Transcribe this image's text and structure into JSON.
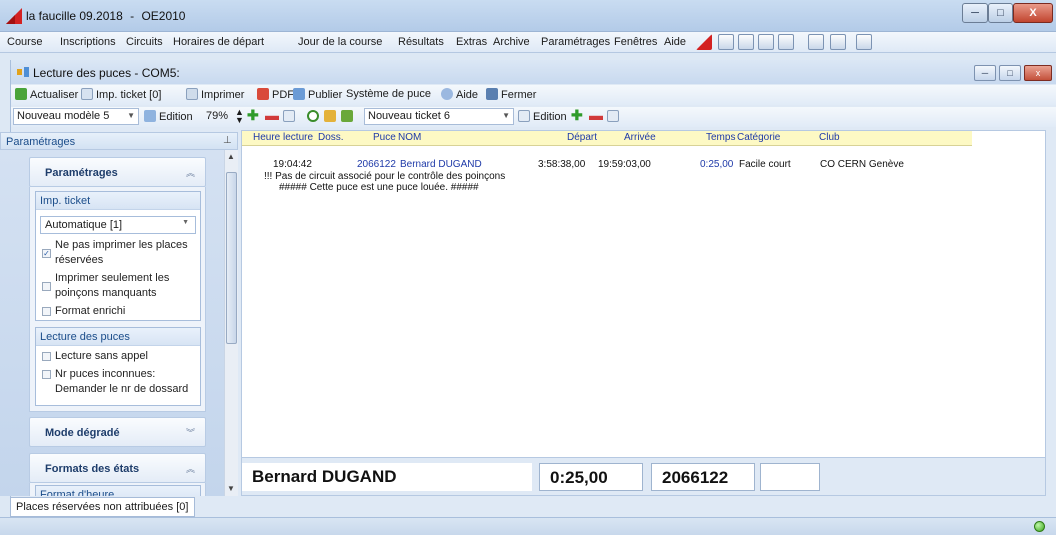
{
  "window": {
    "app_title": "la faucille 09.2018",
    "title_sep": "-",
    "app_module": "OE2010",
    "controls": {
      "minimize": "─",
      "maximize": "□",
      "close": "X"
    }
  },
  "menubar": {
    "items": [
      "Course",
      "Inscriptions",
      "Circuits",
      "Horaires de départ",
      "Jour de la course",
      "Résultats",
      "Extras",
      "Archive",
      "Paramétrages",
      "Fenêtres",
      "Aide"
    ]
  },
  "child": {
    "title": "Lecture des puces - COM5:",
    "controls": {
      "minimize": "─",
      "maximize": "□",
      "close": "x"
    },
    "toolbar1": {
      "refresh": "Actualiser",
      "print_ticket": "Imp. ticket [0]",
      "print": "Imprimer",
      "pdf": "PDF",
      "publish": "Publier",
      "chip_system": "Système de puce",
      "help": "Aide",
      "close": "Fermer"
    },
    "toolbar2": {
      "model_select": "Nouveau modèle 5",
      "edition": "Edition",
      "zoom": "79%",
      "ticket_select": "Nouveau ticket 6",
      "edition2": "Edition"
    }
  },
  "left_panel": {
    "header": "Paramétrages",
    "groups": {
      "parametrages": {
        "title": "Paramétrages",
        "imp_ticket": {
          "label": "Imp. ticket",
          "mode_value": "Automatique [1]",
          "options": [
            {
              "label": "Ne pas imprimer les places réservées",
              "checked": true
            },
            {
              "label": "Imprimer seulement les poinçons manquants",
              "checked": false
            },
            {
              "label": "Format enrichi",
              "checked": false
            }
          ]
        },
        "lecture": {
          "label": "Lecture des puces",
          "options": [
            {
              "label": "Lecture sans appel",
              "checked": false
            },
            {
              "label": "Nr puces inconnues: Demander le nr de dossard",
              "checked": false
            }
          ]
        }
      },
      "mode_degrade": {
        "title": "Mode dégradé"
      },
      "formats": {
        "title": "Formats des états",
        "first_item": "Format d'heure"
      }
    }
  },
  "grid": {
    "columns": [
      "Heure lecture",
      "Doss.",
      "Puce",
      "NOM",
      "Départ",
      "Arrivée",
      "Temps",
      "Catégorie",
      "Club"
    ],
    "row": {
      "heure": "19:04:42",
      "puce": "2066122",
      "nom": "Bernard DUGAND",
      "depart": "3:58:38,00",
      "arrivee": "19:59:03,00",
      "temps": "0:25,00",
      "categorie": "Facile court",
      "club": "CO CERN Genève",
      "msg1": "!!! Pas de circuit associé pour le contrôle des poinçons",
      "msg2": "##### Cette puce est une puce louée. #####"
    }
  },
  "footer": {
    "name": "Bernard DUGAND",
    "time": "0:25,00",
    "chip": "2066122",
    "extra": ""
  },
  "bottom_tab": "Places réservées non attribuées [0]",
  "colors": {
    "grid_header_bg": "#fdf9c4",
    "link_blue": "#1f3aa8",
    "status_ok": "#39a51b"
  }
}
